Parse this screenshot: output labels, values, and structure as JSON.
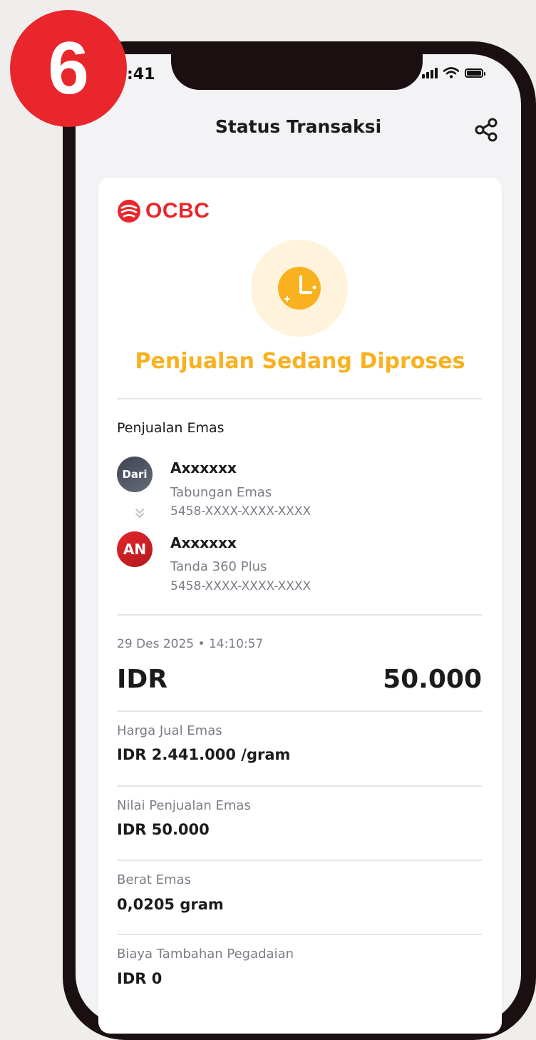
{
  "step_badge": "6",
  "status_bar": {
    "time": ":41"
  },
  "header": {
    "title": "Status Transaksi"
  },
  "logo": {
    "text": "OCBC"
  },
  "status": {
    "text": "Penjualan Sedang Diproses",
    "color": "#f9b11f"
  },
  "transaction": {
    "type": "Penjualan Emas",
    "from": {
      "avatar": "Dari",
      "name": "Axxxxxx",
      "product": "Tabungan Emas",
      "account": "5458-XXXX-XXXX-XXXX"
    },
    "to": {
      "avatar": "AN",
      "name": "Axxxxxx",
      "product": "Tanda 360 Plus",
      "account": "5458-XXXX-XXXX-XXXX"
    },
    "datetime": "29 Des 2025 • 14:10:57",
    "currency": "IDR",
    "amount": "50.000"
  },
  "details": [
    {
      "label": "Harga Jual Emas",
      "value": "IDR 2.441.000 /gram"
    },
    {
      "label": "Nilai Penjualan Emas",
      "value": "IDR 50.000"
    },
    {
      "label": "Berat Emas",
      "value": "0,0205 gram"
    },
    {
      "label": "Biaya Tambahan Pegadaian",
      "value": "IDR 0"
    }
  ],
  "colors": {
    "brand_red": "#e8262b",
    "pending_yellow": "#f9b11f"
  }
}
